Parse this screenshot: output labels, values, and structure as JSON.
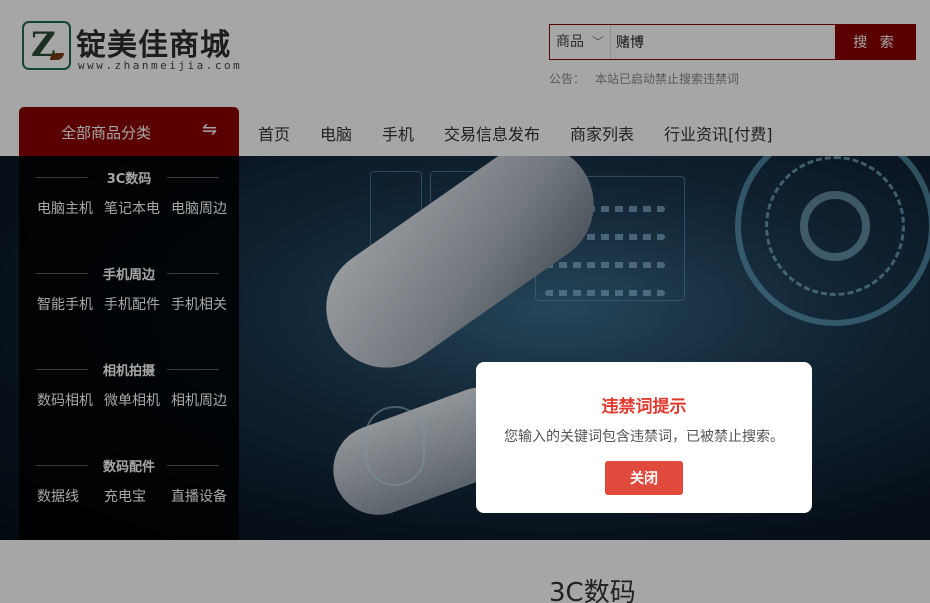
{
  "logo": {
    "mark": "Z",
    "name": "锭美佳商城",
    "url": "www.zhanmeijia.com"
  },
  "search": {
    "category": "商品",
    "value": "赌博",
    "button": "搜 索"
  },
  "notice": {
    "label": "公告：",
    "text": "本站已启动禁止搜索违禁词"
  },
  "nav": {
    "all_categories": "全部商品分类",
    "swap_icon": "⇋",
    "links": [
      "首页",
      "电脑",
      "手机",
      "交易信息发布",
      "商家列表",
      "行业资讯[付费]"
    ]
  },
  "categories": [
    {
      "title": "3C数码",
      "items": [
        "电脑主机",
        "笔记本电",
        "电脑周边"
      ]
    },
    {
      "title": "手机周边",
      "items": [
        "智能手机",
        "手机配件",
        "手机相关"
      ]
    },
    {
      "title": "相机拍摄",
      "items": [
        "数码相机",
        "微单相机",
        "相机周边"
      ]
    },
    {
      "title": "数码配件",
      "items": [
        "数据线",
        "充电宝",
        "直播设备"
      ]
    }
  ],
  "modal": {
    "title": "违禁词提示",
    "message": "您输入的关键词包含违禁词，已被禁止搜索。",
    "button": "关闭"
  },
  "section": {
    "title": "3C数码"
  },
  "colors": {
    "brand": "#8b0000",
    "modal_title": "#e03a2f",
    "modal_button": "#e04a3c"
  }
}
